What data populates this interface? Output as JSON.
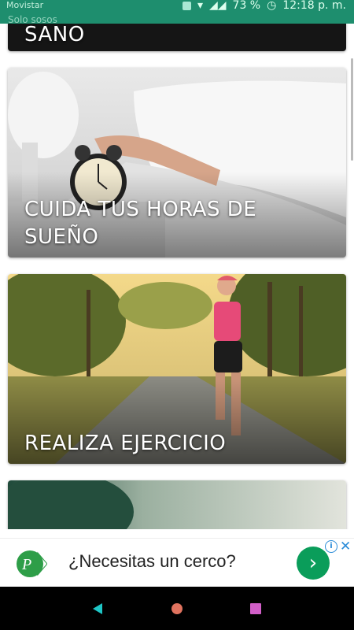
{
  "status_bar": {
    "carrier": "Movistar",
    "secondary": "Solo sosos",
    "battery": "73 %",
    "time": "12:18 p. m."
  },
  "cards": [
    {
      "caption": "MENTE SANA, CUERPO SANO"
    },
    {
      "caption": "CUIDA TUS HORAS DE SUEÑO"
    },
    {
      "caption": "REALIZA EJERCICIO"
    },
    {
      "caption": ""
    }
  ],
  "ad": {
    "headline": "¿Necesitas un cerco?",
    "info_icon": "info-icon",
    "close_icon": "close-icon",
    "button_icon": "chevron-right-icon",
    "accent": "#0a9d5a"
  },
  "nav": {
    "back_icon": "back-triangle-icon",
    "home_icon": "home-circle-icon",
    "recents_icon": "recents-square-icon"
  }
}
